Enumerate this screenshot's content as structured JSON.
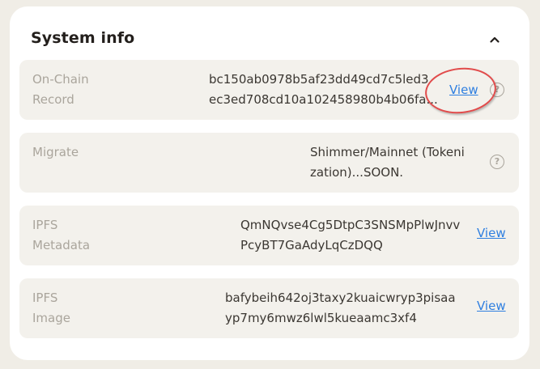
{
  "section": {
    "title": "System info"
  },
  "rows": [
    {
      "label": "On-Chain\nRecord",
      "value_line1": "bc150ab0978b5af23dd49cd7c5led3",
      "value_line2": "ec3ed708cd10a102458980b4b06fa...",
      "link": "View"
    },
    {
      "label": "Migrate",
      "value_line1": "Shimmer/Mainnet (Tokeni",
      "value_line2": "zation)...SOON."
    },
    {
      "label": "IPFS\nMetadata",
      "value_line1": "QmNQvse4Cg5DtpC3SNSMpPlwJnvv",
      "value_line2": "PcyBT7GaAdyLqCzDQQ",
      "link": "View"
    },
    {
      "label": "IPFS\nImage",
      "value_line1": "bafybeih642oj3taxy2kuaicwryp3pisaa",
      "value_line2": "yp7my6mwz6lwl5kueaamc3xf4",
      "link": "View"
    }
  ],
  "icons": {
    "collapse": "chevron-up-icon",
    "help": "question-circle-icon"
  },
  "help_glyph": "?",
  "colors": {
    "link": "#2f7fe0",
    "annotation": "#e14b4b",
    "row_bg": "#f3f1ec"
  }
}
